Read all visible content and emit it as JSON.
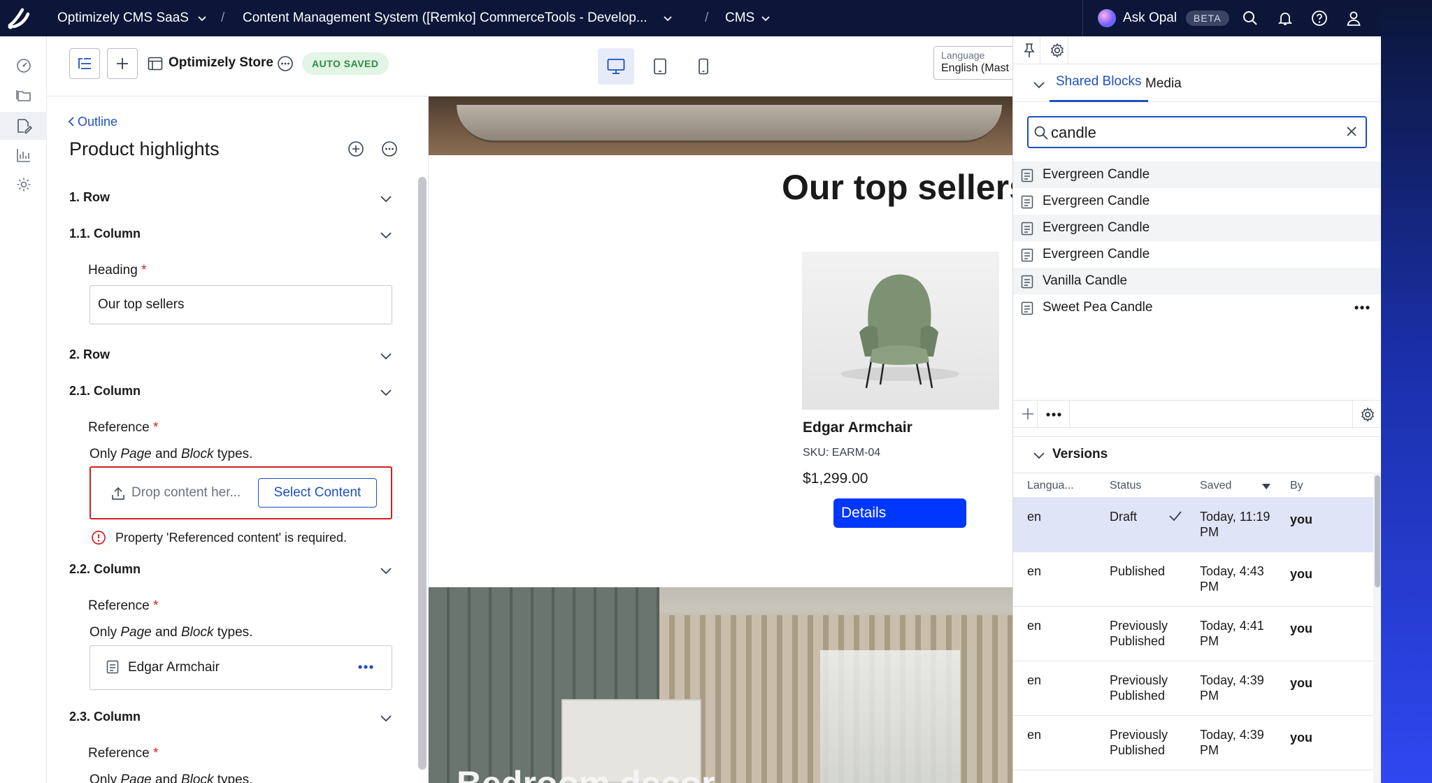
{
  "topbar": {
    "product": "Optimizely CMS SaaS",
    "project": "Content Management System ([Remko] CommerceTools - Develop...",
    "app": "CMS",
    "ask_opal": "Ask Opal",
    "beta": "BETA",
    "icons": [
      "optimizely-logo-icon",
      "search-icon",
      "bell-icon",
      "help-icon",
      "user-icon"
    ]
  },
  "rail": {
    "icons": [
      "dashboard-icon",
      "folders-icon",
      "edit-content-icon",
      "reports-icon",
      "settings-icon"
    ],
    "active_index": 2
  },
  "toolbar": {
    "site_name": "Optimizely Store",
    "status": "AUTO SAVED",
    "language_label": "Language",
    "language_value": "English (Mast"
  },
  "outline": {
    "back_link": "Outline",
    "title": "Product highlights"
  },
  "sections": [
    {
      "title": "1. Row"
    },
    {
      "title": "1.1. Column"
    },
    {
      "title": "2. Row"
    },
    {
      "title": "2.1. Column"
    },
    {
      "title": "2.2. Column"
    },
    {
      "title": "2.3. Column"
    }
  ],
  "fields": {
    "heading_label": "Heading",
    "heading_value": "Our top sellers",
    "reference_label": "Reference",
    "required_mark": "*",
    "only_text": "Only",
    "page_word": "Page",
    "and_word": "and",
    "block_word": "Block",
    "types_word": "types.",
    "drop_placeholder": "Drop content her...",
    "select_content": "Select Content",
    "error_text": "Property 'Referenced content' is required.",
    "referenced_item": "Edgar Armchair"
  },
  "preview": {
    "heading": "Our top sellers",
    "product_name": "Edgar Armchair",
    "sku": "SKU: EARM-04",
    "price": "$1,299.00",
    "details_button": "Details",
    "bottom_heading": "Bedroom decor"
  },
  "rightpanel": {
    "tabs": [
      "Shared Blocks",
      "Media"
    ],
    "active_tab": 0,
    "search_value": "candle",
    "results": [
      "Evergreen Candle",
      "Evergreen Candle",
      "Evergreen Candle",
      "Evergreen Candle",
      "Vanilla Candle",
      "Sweet Pea Candle"
    ],
    "versions_title": "Versions",
    "columns": [
      "Langua...",
      "Status",
      "Saved",
      "By"
    ],
    "versions": [
      {
        "lang": "en",
        "status": "Draft",
        "saved": "Today, 11:19 PM",
        "by": "you",
        "current": true
      },
      {
        "lang": "en",
        "status": "Published",
        "saved": "Today, 4:43 PM",
        "by": "you",
        "current": false
      },
      {
        "lang": "en",
        "status": "Previously Published",
        "saved": "Today, 4:41 PM",
        "by": "you",
        "current": false
      },
      {
        "lang": "en",
        "status": "Previously Published",
        "saved": "Today, 4:39 PM",
        "by": "you",
        "current": false
      },
      {
        "lang": "en",
        "status": "Previously Published",
        "saved": "Today, 4:39 PM",
        "by": "you",
        "current": false
      }
    ]
  },
  "colors": {
    "topbar": "#0b1638",
    "accent": "#0037ff",
    "link": "#1f4fc2",
    "saved_badge_bg": "#e2f5e6",
    "saved_badge_text": "#2e8a47",
    "error": "#d21f1f",
    "selected_row": "#dfe5f7"
  }
}
